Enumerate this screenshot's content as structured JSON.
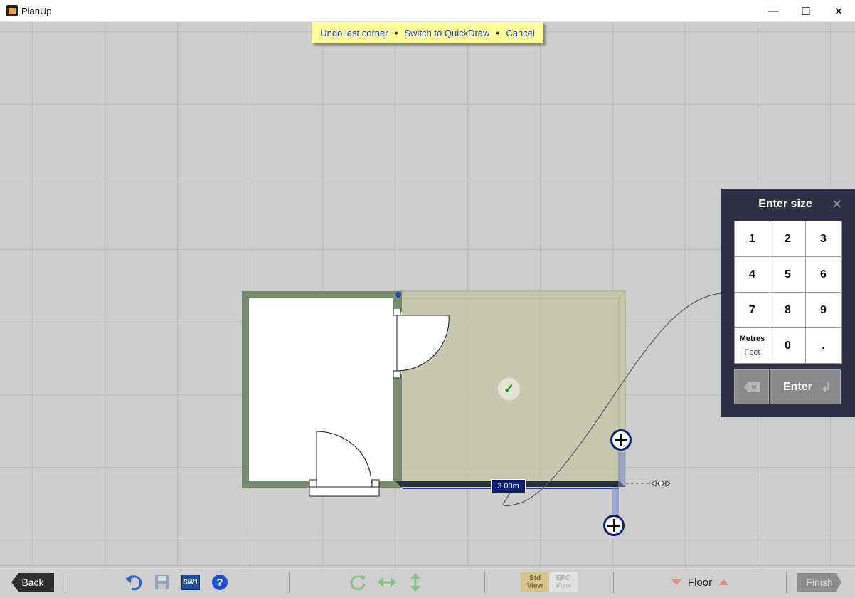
{
  "window": {
    "title": "PlanUp",
    "minimize": "—",
    "maximize": "☐",
    "close": "✕"
  },
  "hint_bar": {
    "undo": "Undo last corner",
    "switch": "Switch to QuickDraw",
    "cancel": "Cancel",
    "separator": "•"
  },
  "canvas": {
    "dimension_label": "3.00m",
    "confirm_symbol": "✓"
  },
  "keypad": {
    "title": "Enter size",
    "close": "✕",
    "keys": [
      "1",
      "2",
      "3",
      "4",
      "5",
      "6",
      "7",
      "8",
      "9"
    ],
    "unit_primary": "Metres",
    "unit_secondary": "Feet",
    "zero": "0",
    "decimal": ".",
    "enter": "Enter",
    "enter_icon": "↲"
  },
  "toolbar": {
    "back": "Back",
    "sw1": "SW1",
    "help": "?",
    "std_view_line1": "Std",
    "std_view_line2": "View",
    "epc_view_line1": "EPC",
    "epc_view_line2": "View",
    "floor": "Floor",
    "finish": "Finish"
  },
  "colors": {
    "wall": "#7a8a70",
    "room_fill": "#ffffff",
    "new_room_fill": "#c6c6a4",
    "hint_bg": "#ffff99",
    "link": "#1a3acc",
    "keypad_bg": "#2f2f45",
    "label_bg": "#0a1e78"
  }
}
